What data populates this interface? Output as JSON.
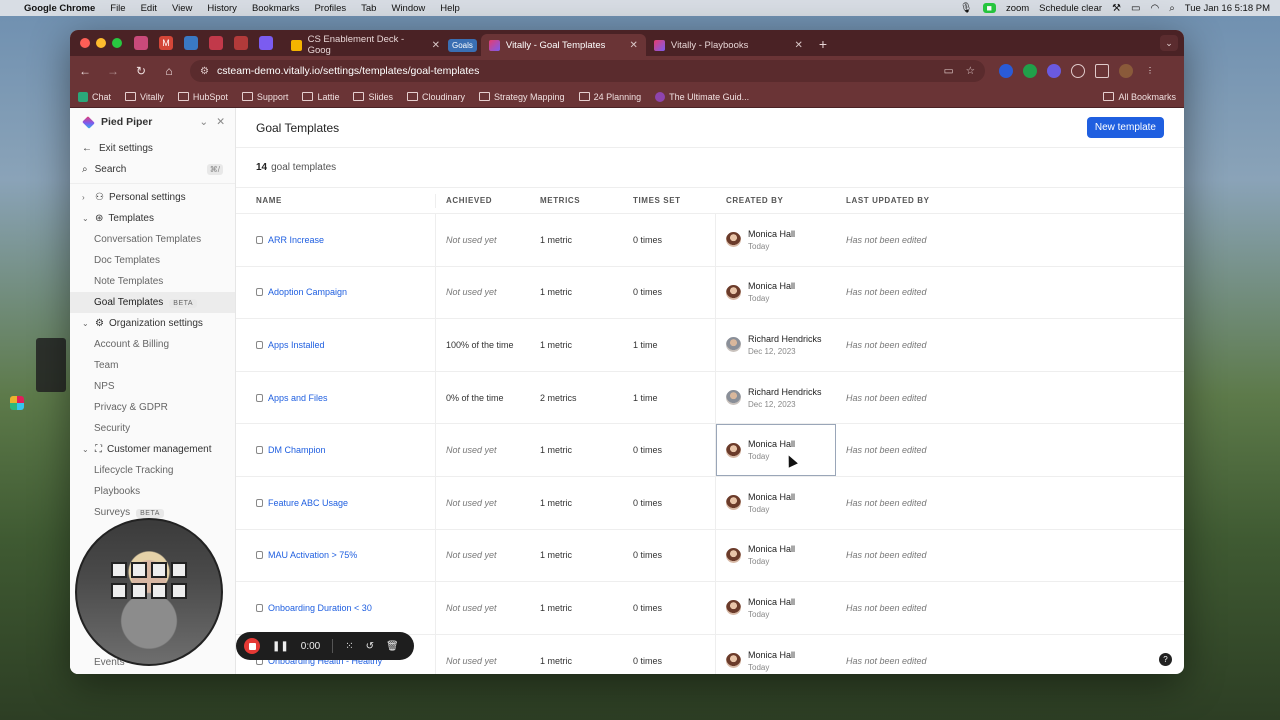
{
  "menubar": {
    "app": "Google Chrome",
    "menus": [
      "File",
      "Edit",
      "View",
      "History",
      "Bookmarks",
      "Profiles",
      "Tab",
      "Window",
      "Help"
    ],
    "zoom_label": "zoom",
    "schedule_label": "Schedule clear",
    "datetime": "Tue Jan 16  5:18 PM"
  },
  "browser": {
    "tabs": [
      {
        "title": "CS Enablement Deck - Goog",
        "active": false
      },
      {
        "title": "Vitally - Goal Templates",
        "active": true
      },
      {
        "title": "Vitally - Playbooks",
        "active": false
      }
    ],
    "goals_chip": "Goals",
    "url": "csteam-demo.vitally.io/settings/templates/goal-templates",
    "bookmarks": [
      "Chat",
      "Vitally",
      "HubSpot",
      "Support",
      "Lattie",
      "Slides",
      "Cloudinary",
      "Strategy Mapping",
      "24 Planning",
      "The Ultimate Guid..."
    ],
    "all_bookmarks": "All Bookmarks"
  },
  "sidebar": {
    "org_name": "Pied Piper",
    "exit_settings": "Exit settings",
    "search": "Search",
    "search_kbd": "⌘/",
    "personal_settings": "Personal settings",
    "templates": "Templates",
    "template_items": [
      "Conversation Templates",
      "Doc Templates",
      "Note Templates",
      "Goal Templates"
    ],
    "beta": "BETA",
    "organization_settings": "Organization settings",
    "org_items": [
      "Account & Billing",
      "Team",
      "NPS",
      "Privacy & GDPR",
      "Security"
    ],
    "customer_management": "Customer management",
    "cm_items": [
      "Lifecycle Tracking",
      "Playbooks",
      "Surveys"
    ],
    "events_partial": "Events"
  },
  "main": {
    "title": "Goal Templates",
    "new_button": "New template",
    "count": "14",
    "count_label": "goal templates",
    "columns": [
      "NAME",
      "ACHIEVED",
      "METRICS",
      "TIMES SET",
      "CREATED BY",
      "LAST UPDATED BY"
    ],
    "rows": [
      {
        "name": "ARR Increase",
        "achieved": "Not used yet",
        "metrics": "1 metric",
        "times": "0 times",
        "by": "Monica Hall",
        "date": "Today",
        "updated": "Has not been edited"
      },
      {
        "name": "Adoption Campaign",
        "achieved": "Not used yet",
        "metrics": "1 metric",
        "times": "0 times",
        "by": "Monica Hall",
        "date": "Today",
        "updated": "Has not been edited"
      },
      {
        "name": "Apps Installed",
        "achieved": "100% of the time",
        "metrics": "1 metric",
        "times": "1 time",
        "by": "Richard Hendricks",
        "date": "Dec 12, 2023",
        "updated": "Has not been edited"
      },
      {
        "name": "Apps and Files",
        "achieved": "0% of the time",
        "metrics": "2 metrics",
        "times": "1 time",
        "by": "Richard Hendricks",
        "date": "Dec 12, 2023",
        "updated": "Has not been edited"
      },
      {
        "name": "DM Champion",
        "achieved": "Not used yet",
        "metrics": "1 metric",
        "times": "0 times",
        "by": "Monica Hall",
        "date": "Today",
        "updated": "Has not been edited"
      },
      {
        "name": "Feature ABC Usage",
        "achieved": "Not used yet",
        "metrics": "1 metric",
        "times": "0 times",
        "by": "Monica Hall",
        "date": "Today",
        "updated": "Has not been edited"
      },
      {
        "name": "MAU Activation > 75%",
        "achieved": "Not used yet",
        "metrics": "1 metric",
        "times": "0 times",
        "by": "Monica Hall",
        "date": "Today",
        "updated": "Has not been edited"
      },
      {
        "name": "Onboarding Duration < 30",
        "achieved": "Not used yet",
        "metrics": "1 metric",
        "times": "0 times",
        "by": "Monica Hall",
        "date": "Today",
        "updated": "Has not been edited"
      },
      {
        "name": "Onboarding Health - Healthy",
        "achieved": "Not used yet",
        "metrics": "1 metric",
        "times": "0 times",
        "by": "Monica Hall",
        "date": "Today",
        "updated": "Has not been edited"
      }
    ]
  },
  "recorder": {
    "time": "0:00"
  },
  "colors": {
    "accent": "#1f5fe0",
    "chrome_frame": "#6a3436",
    "record_red": "#e53935"
  }
}
